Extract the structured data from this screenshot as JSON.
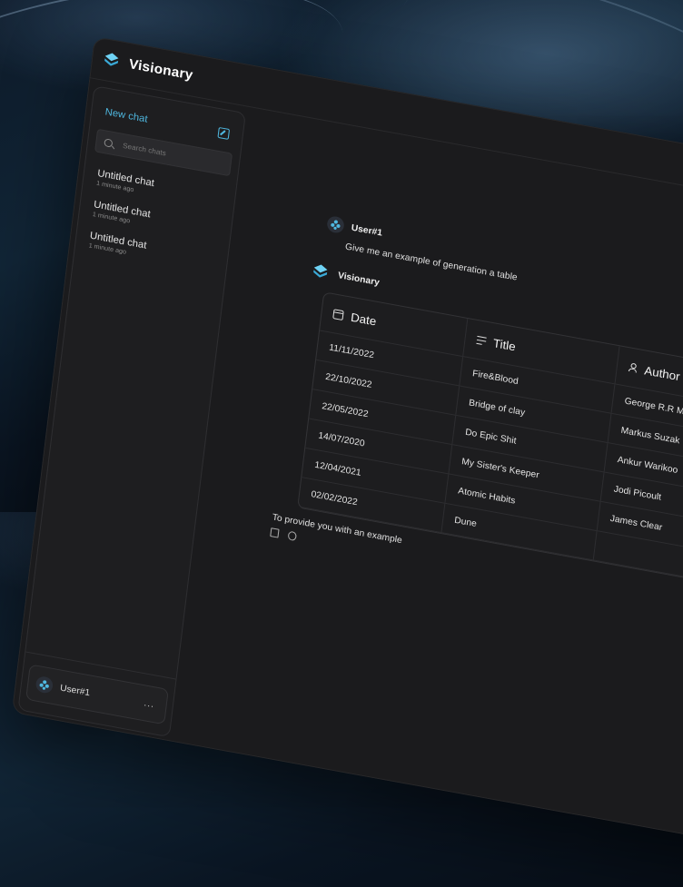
{
  "app": {
    "title": "Visionary",
    "accent": "#4fb8e0"
  },
  "sidebar": {
    "new_chat_label": "New chat",
    "search_placeholder": "Search chats",
    "chats": [
      {
        "title": "Untitled chat",
        "time": "1 minute ago"
      },
      {
        "title": "Untitled chat",
        "time": "1 minute ago"
      },
      {
        "title": "Untitled chat",
        "time": "1 minute ago"
      }
    ],
    "user_name": "User#1",
    "more_label": "..."
  },
  "conversation": {
    "user_author": "User#1",
    "user_message": "Give me an example of generation a table",
    "assistant_author": "Visionary",
    "table": {
      "headers": [
        "Date",
        "Title",
        "Author"
      ],
      "rows": [
        [
          "11/11/2022",
          "Fire&Blood",
          "George R.R Martin"
        ],
        [
          "22/10/2022",
          "Bridge of clay",
          "Markus Suzak"
        ],
        [
          "22/05/2022",
          "Do Epic Shit",
          "Ankur Warikoo"
        ],
        [
          "14/07/2020",
          "My Sister's Keeper",
          "Jodi Picoult"
        ],
        [
          "12/04/2021",
          "Atomic Habits",
          "James Clear"
        ],
        [
          "02/02/2022",
          "Dune",
          ""
        ]
      ]
    },
    "footer_text": "To provide you with an example"
  }
}
